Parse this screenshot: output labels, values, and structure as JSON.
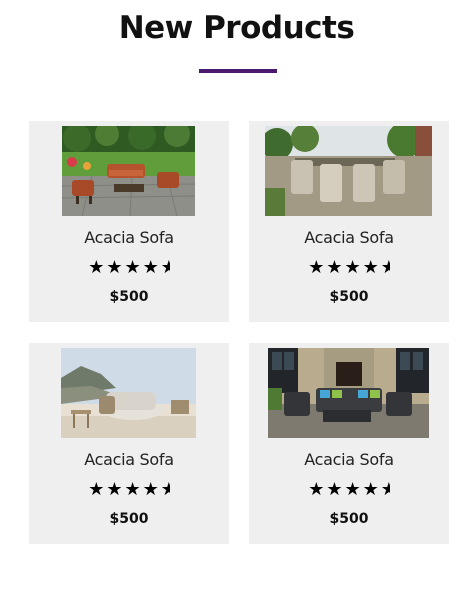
{
  "section": {
    "title": "New Products"
  },
  "products": [
    {
      "name": "Acacia Sofa",
      "price": "$500",
      "rating": 4.5,
      "image": "garden-sofa-set-photo"
    },
    {
      "name": "Acacia Sofa",
      "price": "$500",
      "rating": 4.5,
      "image": "patio-dining-set-photo"
    },
    {
      "name": "Acacia Sofa",
      "price": "$500",
      "rating": 4.5,
      "image": "seaside-daybed-photo"
    },
    {
      "name": "Acacia Sofa",
      "price": "$500",
      "rating": 4.5,
      "image": "wicker-lounge-set-photo"
    }
  ],
  "colors": {
    "accent": "#4b1a6e",
    "card_bg": "#efefef"
  }
}
